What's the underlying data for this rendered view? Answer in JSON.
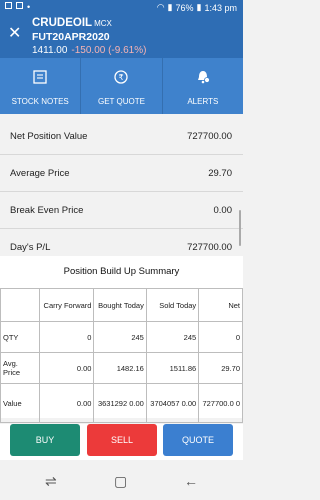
{
  "status_bar": {
    "battery": "76%",
    "time": "1:43 pm"
  },
  "header": {
    "symbol": "CRUDEOIL",
    "exchange": "MCX",
    "contract": "FUT20APR2020",
    "price": "1411.00",
    "change": "-150.00 (-9.61%)"
  },
  "actions": [
    {
      "label": "STOCK NOTES",
      "icon": "notes-icon"
    },
    {
      "label": "GET QUOTE",
      "icon": "rupee-icon"
    },
    {
      "label": "ALERTS",
      "icon": "bell-plus-icon"
    }
  ],
  "summary": [
    {
      "label": "Net Position Value",
      "value": "727700.00"
    },
    {
      "label": "Average Price",
      "value": "29.70"
    },
    {
      "label": "Break Even Price",
      "value": "0.00"
    },
    {
      "label": "Day's P/L",
      "value": "727700.00"
    }
  ],
  "build_up": {
    "title": "Position Build Up Summary",
    "headers": [
      "",
      "Carry Forward",
      "Bought Today",
      "Sold Today",
      "Net"
    ],
    "rows": [
      {
        "label": "QTY",
        "cells": [
          "0",
          "245",
          "245",
          "0"
        ]
      },
      {
        "label": "Avg. Price",
        "cells": [
          "0.00",
          "1482.16",
          "1511.86",
          "29.70"
        ]
      },
      {
        "label": "Value",
        "cells": [
          "0.00",
          "3631292 0.00",
          "3704057 0.00",
          "727700.0 0"
        ]
      }
    ]
  },
  "buttons": {
    "buy": "BUY",
    "sell": "SELL",
    "quote": "QUOTE"
  },
  "colors": {
    "header": "#2e6db4",
    "actionbar": "#3f82cc",
    "buy": "#1d8b73",
    "sell": "#ec3a3a",
    "quote": "#3b7fd0",
    "change": "#f5b3b3"
  }
}
